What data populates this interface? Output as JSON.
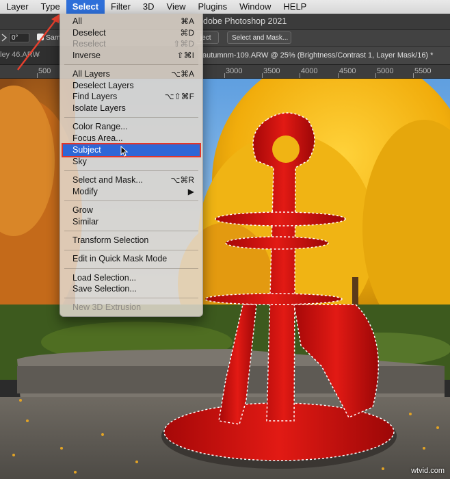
{
  "menubar": {
    "items": [
      "Layer",
      "Type",
      "Select",
      "Filter",
      "3D",
      "View",
      "Plugins",
      "Window",
      "HELP"
    ],
    "active_index": 2
  },
  "app": {
    "title": "dobe Photoshop 2021"
  },
  "options_bar": {
    "angle_value": "0°",
    "sample_label": "Sam",
    "subject_button_partial": "ject",
    "select_and_mask_button": "Select and Mask..."
  },
  "document_tabs": {
    "inactive_tab": "ley 46.ARW",
    "active_tab": "autumnm-109.ARW @ 25% (Brightness/Contrast 1, Layer Mask/16) *"
  },
  "ruler": {
    "labels": [
      "500",
      "3000",
      "3500",
      "4000",
      "4500",
      "5000",
      "5500"
    ]
  },
  "select_menu": {
    "items": [
      {
        "label": "All",
        "shortcut": "⌘A",
        "state": "normal"
      },
      {
        "label": "Deselect",
        "shortcut": "⌘D",
        "state": "normal"
      },
      {
        "label": "Reselect",
        "shortcut": "⇧⌘D",
        "state": "disabled"
      },
      {
        "label": "Inverse",
        "shortcut": "⇧⌘I",
        "state": "normal"
      },
      {
        "label": "All Layers",
        "shortcut": "⌥⌘A",
        "state": "normal"
      },
      {
        "label": "Deselect Layers",
        "shortcut": "",
        "state": "normal"
      },
      {
        "label": "Find Layers",
        "shortcut": "⌥⇧⌘F",
        "state": "normal"
      },
      {
        "label": "Isolate Layers",
        "shortcut": "",
        "state": "normal"
      },
      {
        "label": "Color Range...",
        "shortcut": "",
        "state": "normal"
      },
      {
        "label": "Focus Area...",
        "shortcut": "",
        "state": "normal"
      },
      {
        "label": "Subject",
        "shortcut": "",
        "state": "highlighted"
      },
      {
        "label": "Sky",
        "shortcut": "",
        "state": "normal"
      },
      {
        "label": "Select and Mask...",
        "shortcut": "⌥⌘R",
        "state": "normal"
      },
      {
        "label": "Modify",
        "shortcut": "▶",
        "state": "normal"
      },
      {
        "label": "Grow",
        "shortcut": "",
        "state": "normal"
      },
      {
        "label": "Similar",
        "shortcut": "",
        "state": "normal"
      },
      {
        "label": "Transform Selection",
        "shortcut": "",
        "state": "normal"
      },
      {
        "label": "Edit in Quick Mask Mode",
        "shortcut": "",
        "state": "normal"
      },
      {
        "label": "Load Selection...",
        "shortcut": "",
        "state": "normal"
      },
      {
        "label": "Save Selection...",
        "shortcut": "",
        "state": "normal"
      },
      {
        "label": "New 3D Extrusion",
        "shortcut": "",
        "state": "disabled"
      }
    ]
  },
  "watermark": "wtvid.com",
  "colors": {
    "menu_highlight": "#2e67d6",
    "highlight_border": "#e2352a",
    "annotation_arrow": "#e8402e",
    "sculpture_red": "#d01212",
    "foliage_yellow": "#f2b510"
  },
  "canvas": {
    "image": "autumn park with red abstract sculpture, marching-ants selection around subject"
  }
}
